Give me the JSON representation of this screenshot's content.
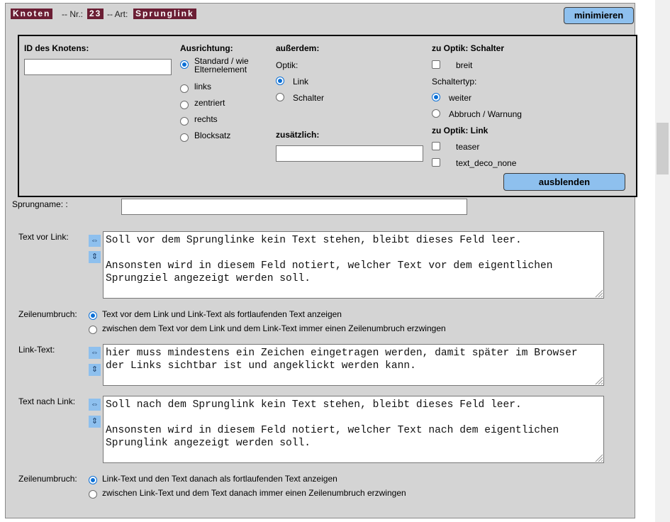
{
  "header": {
    "knoten_label": "Knoten",
    "nr_sep": "-- Nr.:",
    "nr_value": "23",
    "art_sep": "-- Art:",
    "art_value": "Sprunglink",
    "minimize_label": "minimieren"
  },
  "options": {
    "id_label": "ID des Knotens:",
    "id_value": "",
    "alignment_label": "Ausrichtung:",
    "alignment_options": [
      "Standard / wie Elternelement",
      "links",
      "zentriert",
      "rechts",
      "Blocksatz"
    ],
    "alignment_selected": "Standard / wie Elternelement",
    "ausserdem_label": "außerdem:",
    "optik_label": "Optik:",
    "optik_options": [
      "Link",
      "Schalter"
    ],
    "optik_selected": "Link",
    "zusaetzlich_label": "zusätzlich:",
    "zusaetzlich_value": "",
    "schalter_heading": "zu Optik: Schalter",
    "breit_label": "breit",
    "schaltertyp_label": "Schaltertyp:",
    "schaltertyp_options": [
      "weiter",
      "Abbruch / Warnung"
    ],
    "schaltertyp_selected": "weiter",
    "link_heading": "zu Optik: Link",
    "teaser_label": "teaser",
    "text_deco_label": "text_deco_none",
    "hide_label": "ausblenden"
  },
  "form": {
    "sprungname_label": "Sprungname: :",
    "sprungname_value": "",
    "text_vor_label": "Text vor Link:",
    "text_vor_value": "Soll vor dem Sprunglinke kein Text stehen, bleibt dieses Feld leer.\n\nAnsonsten wird in diesem Feld notiert, welcher Text vor dem eigentlichen Sprungziel angezeigt werden soll.",
    "zeilenumbruch_label": "Zeilenumbruch:",
    "umbruch1_options": [
      "Text vor dem Link und Link-Text als fortlaufenden Text anzeigen",
      "zwischen dem Text vor dem Link und dem Link-Text immer einen Zeilenumbruch erzwingen"
    ],
    "umbruch1_selected": 0,
    "link_text_label": "Link-Text:",
    "link_text_value": "hier muss mindestens ein Zeichen eingetragen werden, damit später im Browser der Links sichtbar ist und angeklickt werden kann.",
    "text_nach_label": "Text nach Link:",
    "text_nach_value": "Soll nach dem Sprunglink kein Text stehen, bleibt dieses Feld leer.\n\nAnsonsten wird in diesem Feld notiert, welcher Text nach dem eigentlichen Sprunglink angezeigt werden soll.",
    "zeilenumbruch2_label": "Zeilenumbruch:",
    "umbruch2_options": [
      "Link-Text und den Text danach als fortlaufenden Text anzeigen",
      "zwischen Link-Text und dem Text danach immer einen Zeilenumbruch erzwingen"
    ],
    "umbruch2_selected": 0
  },
  "icons": {
    "expand_width": "⇔",
    "expand_height": "⇕"
  },
  "colors": {
    "panel_bg": "#d4d4d4",
    "header_tag_bg": "#6b1e34",
    "button_bg": "#8ec0ee",
    "radio_accent": "#0a6fd6"
  }
}
